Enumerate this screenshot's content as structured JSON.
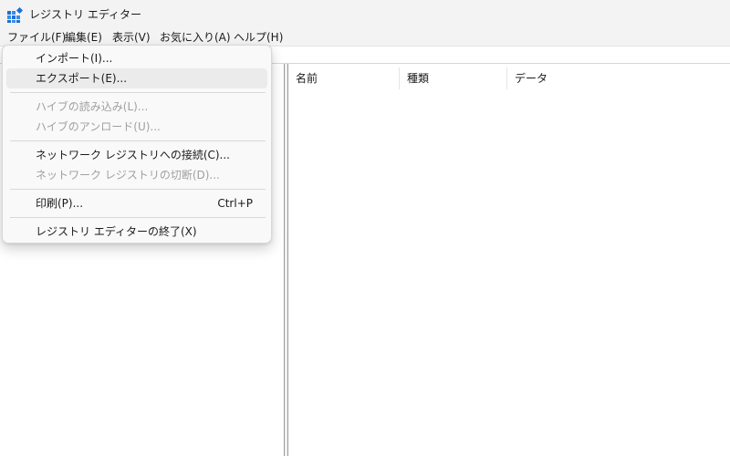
{
  "window": {
    "title": "レジストリ エディター",
    "icon": "registry-editor-icon"
  },
  "menubar": {
    "items": [
      {
        "label": "ファイル(F)"
      },
      {
        "label": "編集(E)"
      },
      {
        "label": "表示(V)"
      },
      {
        "label": "お気に入り(A)"
      },
      {
        "label": "ヘルプ(H)"
      }
    ]
  },
  "list": {
    "columns": [
      {
        "label": "名前"
      },
      {
        "label": "種類"
      },
      {
        "label": "データ"
      }
    ]
  },
  "file_menu": {
    "items": [
      {
        "label": "インポート(I)...",
        "enabled": true
      },
      {
        "label": "エクスポート(E)...",
        "enabled": true,
        "highlighted": true
      },
      {
        "label": "ハイブの読み込み(L)...",
        "enabled": false
      },
      {
        "label": "ハイブのアンロード(U)...",
        "enabled": false
      },
      {
        "label": "ネットワーク レジストリへの接続(C)...",
        "enabled": true
      },
      {
        "label": "ネットワーク レジストリの切断(D)...",
        "enabled": false
      },
      {
        "label": "印刷(P)...",
        "shortcut": "Ctrl+P",
        "enabled": true
      },
      {
        "label": "レジストリ エディターの終了(X)",
        "enabled": true
      }
    ]
  },
  "colors": {
    "titlebar_bg": "#f3f3f3",
    "menu_bg": "#f9f9f9",
    "highlight_bg": "#ebebeb",
    "disabled_text": "#a0a0a0",
    "icon_blue": "#1e6fd9"
  }
}
